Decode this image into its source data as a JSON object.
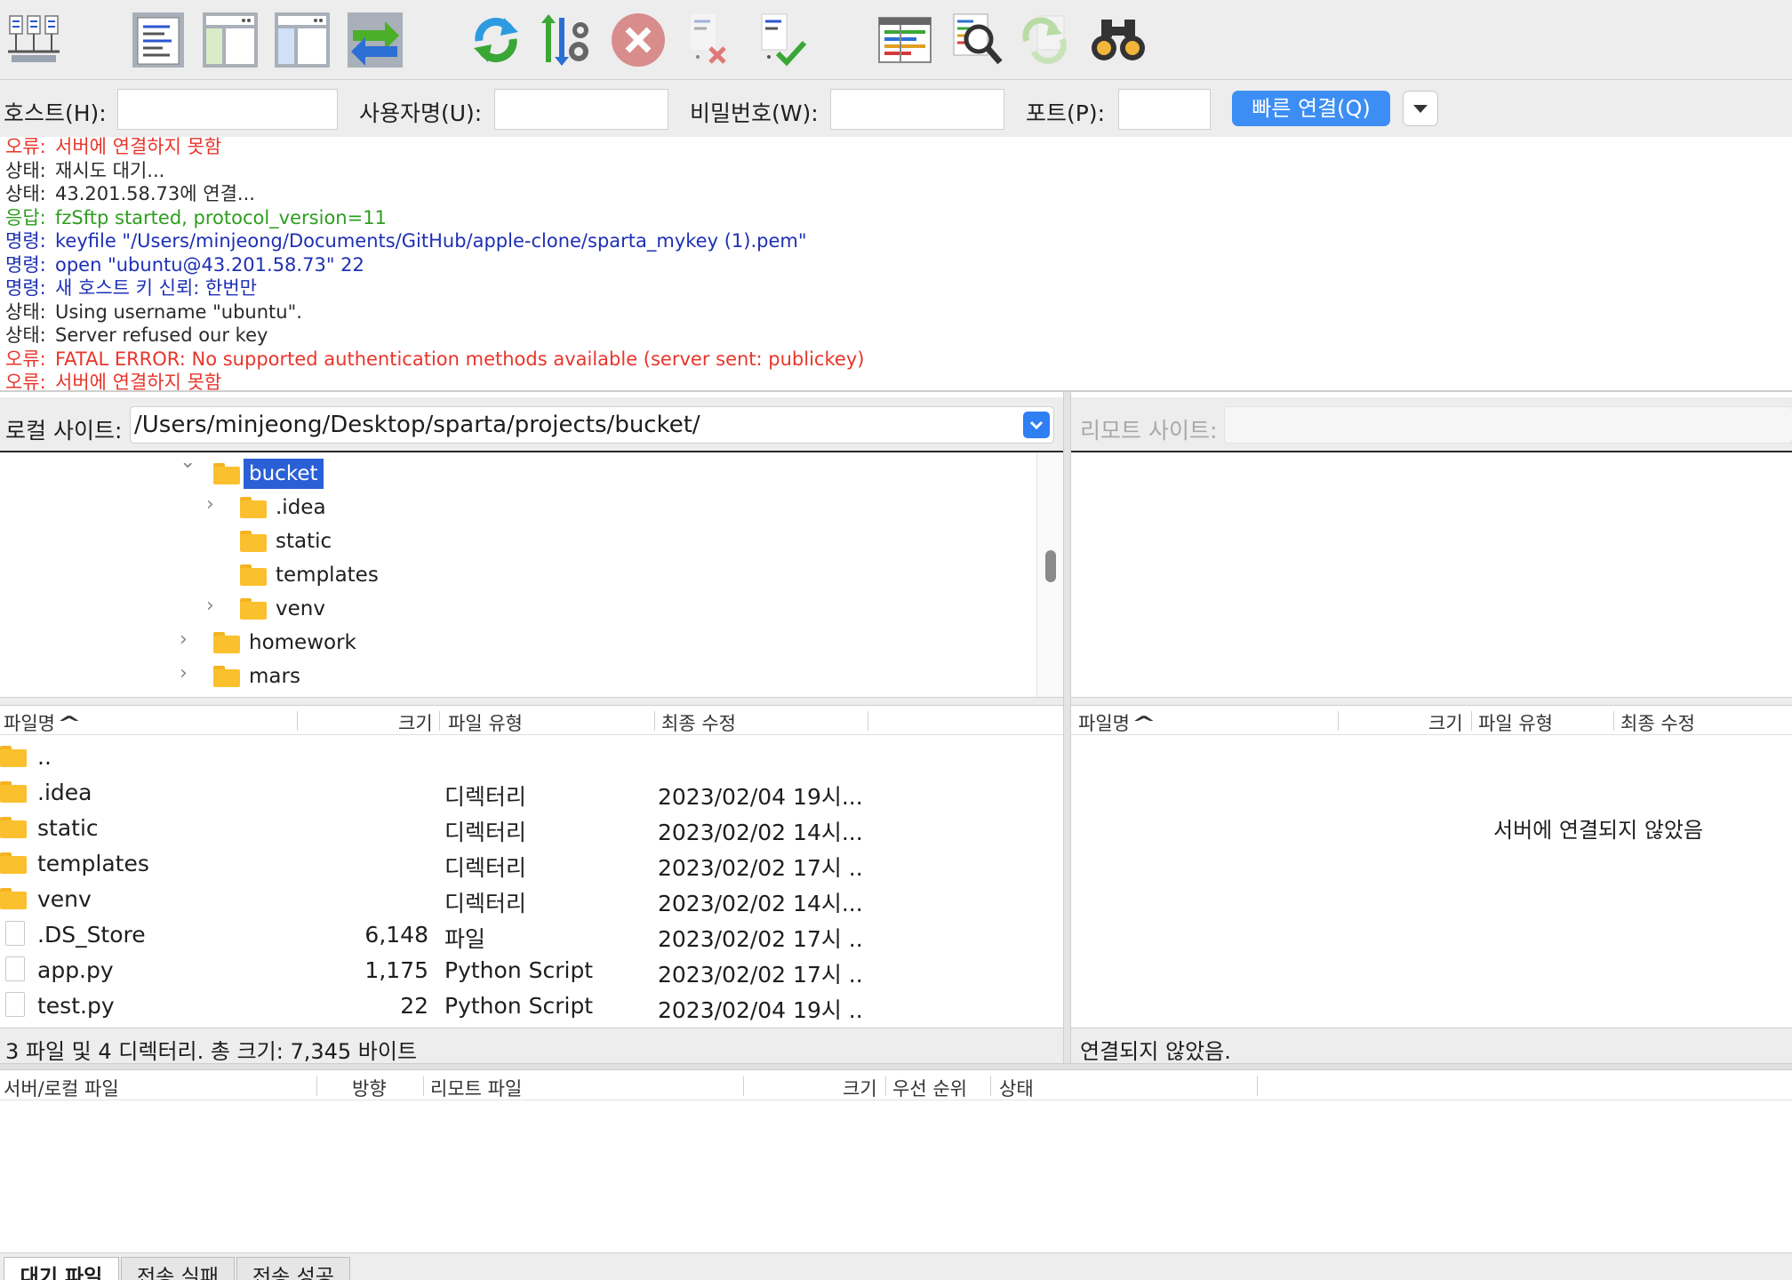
{
  "toolbar": {
    "icons": [
      "site-manager-icon",
      "toggle-message-log-icon",
      "toggle-local-tree-icon",
      "toggle-remote-tree-icon",
      "toggle-transfer-queue-icon",
      "refresh-icon",
      "process-queue-icon",
      "cancel-icon",
      "disconnect-icon",
      "reconnect-icon",
      "directory-filter-icon",
      "directory-compare-icon",
      "sync-browsing-icon",
      "search-remote-files-icon"
    ]
  },
  "quickconnect": {
    "host_label": "호스트(H):",
    "user_label": "사용자명(U):",
    "pass_label": "비밀번호(W):",
    "port_label": "포트(P):",
    "host_value": "",
    "user_value": "",
    "pass_value": "",
    "port_value": "",
    "connect_label": "빠른 연결(Q)"
  },
  "log": [
    {
      "prefix": "오류:",
      "text": "서버에 연결하지 못함",
      "kind": "error"
    },
    {
      "prefix": "상태:",
      "text": "재시도 대기...",
      "kind": "status"
    },
    {
      "prefix": "상태:",
      "text": "43.201.58.73에 연결...",
      "kind": "status"
    },
    {
      "prefix": "응답:",
      "text": "fzSftp started, protocol_version=11",
      "kind": "response"
    },
    {
      "prefix": "명령:",
      "text": "keyfile \"/Users/minjeong/Documents/GitHub/apple-clone/sparta_mykey (1).pem\"",
      "kind": "command"
    },
    {
      "prefix": "명령:",
      "text": "open \"ubuntu@43.201.58.73\" 22",
      "kind": "command"
    },
    {
      "prefix": "명령:",
      "text": "새 호스트 키 신뢰: 한번만",
      "kind": "command"
    },
    {
      "prefix": "상태:",
      "text": "Using username \"ubuntu\".",
      "kind": "status"
    },
    {
      "prefix": "상태:",
      "text": "Server refused our key",
      "kind": "status"
    },
    {
      "prefix": "오류:",
      "text": "FATAL ERROR: No supported authentication methods available (server sent: publickey)",
      "kind": "error"
    },
    {
      "prefix": "오류:",
      "text": "서버에 연결하지 못함",
      "kind": "error"
    }
  ],
  "log_colors": {
    "error": "#e8352b",
    "status": "#2a2a2a",
    "response": "#2e9d1f",
    "command": "#1d2fb5"
  },
  "local": {
    "site_label": "로컬 사이트:",
    "path": "/Users/minjeong/Desktop/sparta/projects/bucket/",
    "tree": [
      {
        "name": "bucket",
        "selected": true,
        "chevron": "⌄"
      },
      {
        "name": ".idea",
        "chevron": "›"
      },
      {
        "name": "static",
        "chevron": ""
      },
      {
        "name": "templates",
        "chevron": ""
      },
      {
        "name": "venv",
        "chevron": "›"
      },
      {
        "name": "homework",
        "chevron": "›"
      },
      {
        "name": "mars",
        "chevron": "›"
      }
    ],
    "columns": {
      "name": "파일명",
      "size": "크기",
      "type": "파일 유형",
      "modified": "최종 수정"
    },
    "sort_indicator": "^",
    "files": [
      {
        "name": "..",
        "size": "",
        "type": "",
        "modified": "",
        "kind": "folder"
      },
      {
        "name": ".idea",
        "size": "",
        "type": "디렉터리",
        "modified": "2023/02/04 19시...",
        "kind": "folder"
      },
      {
        "name": "static",
        "size": "",
        "type": "디렉터리",
        "modified": "2023/02/02 14시...",
        "kind": "folder"
      },
      {
        "name": "templates",
        "size": "",
        "type": "디렉터리",
        "modified": "2023/02/02 17시 ..",
        "kind": "folder"
      },
      {
        "name": "venv",
        "size": "",
        "type": "디렉터리",
        "modified": "2023/02/02 14시...",
        "kind": "folder"
      },
      {
        "name": ".DS_Store",
        "size": "6,148",
        "type": "파일",
        "modified": "2023/02/02 17시 ..",
        "kind": "file"
      },
      {
        "name": "app.py",
        "size": "1,175",
        "type": "Python Script",
        "modified": "2023/02/02 17시 ..",
        "kind": "file"
      },
      {
        "name": "test.py",
        "size": "22",
        "type": "Python Script",
        "modified": "2023/02/04 19시 ..",
        "kind": "file"
      }
    ],
    "status": "3 파일 및 4 디렉터리. 총 크기: 7,345 바이트"
  },
  "remote": {
    "site_label": "리모트 사이트:",
    "path": "",
    "columns": {
      "name": "파일명",
      "size": "크기",
      "type": "파일 유형",
      "modified": "최종 수정"
    },
    "sort_indicator": "^",
    "empty_message": "서버에 연결되지 않았음",
    "status": "연결되지 않았음."
  },
  "queue": {
    "columns": {
      "server_local": "서버/로컬 파일",
      "direction": "방향",
      "remote": "리모트 파일",
      "size": "크기",
      "priority": "우선 순위",
      "status": "상태"
    },
    "tabs": [
      "대기 파일",
      "전송 실패",
      "전송 성공"
    ]
  }
}
